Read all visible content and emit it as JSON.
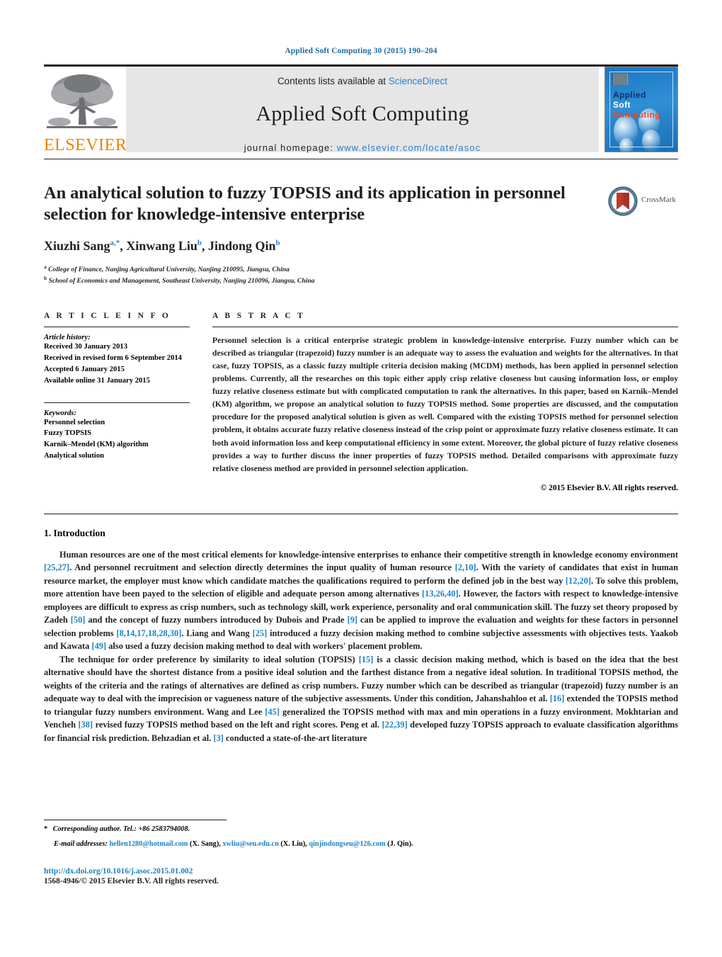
{
  "running_head": "Applied Soft Computing 30 (2015) 190–204",
  "masthead": {
    "publisher_word": "ELSEVIER",
    "contents_prefix": "Contents lists available at ",
    "contents_link": "ScienceDirect",
    "journal_title": "Applied Soft Computing",
    "homepage_label": "journal homepage:",
    "homepage_url": "www.elsevier.com/locate/asoc",
    "cover": {
      "line1": "Applied",
      "line2": "Soft",
      "line3": "Computing"
    }
  },
  "article": {
    "title": "An analytical solution to fuzzy TOPSIS and its application in personnel selection for knowledge-intensive enterprise",
    "authors_html": "Xiuzhi Sang<sup>a,*</sup>, Xinwang Liu<sup>b</sup>, Jindong Qin<sup>b</sup>",
    "affiliations": [
      {
        "mark": "a",
        "text": "College of Finance, Nanjing Agricultural University, Nanjing 210095, Jiangsu, China"
      },
      {
        "mark": "b",
        "text": "School of Economics and Management, Southeast University, Nanjing 210096, Jiangsu, China"
      }
    ],
    "crossmark_label": "CrossMark"
  },
  "info": {
    "heading": "A R T I C L E   I N F O",
    "history_title": "Article history:",
    "history": [
      "Received 30 January 2013",
      "Received in revised form 6 September 2014",
      "Accepted 6 January 2015",
      "Available online 31 January 2015"
    ],
    "keywords_title": "Keywords:",
    "keywords": [
      "Personnel selection",
      "Fuzzy TOPSIS",
      "Karnik–Mendel (KM) algorithm",
      "Analytical solution"
    ]
  },
  "abstract": {
    "heading": "A B S T R A C T",
    "text": "Personnel selection is a critical enterprise strategic problem in knowledge-intensive enterprise. Fuzzy number which can be described as triangular (trapezoid) fuzzy number is an adequate way to assess the evaluation and weights for the alternatives. In that case, fuzzy TOPSIS, as a classic fuzzy multiple criteria decision making (MCDM) methods, has been applied in personnel selection problems. Currently, all the researches on this topic either apply crisp relative closeness but causing information loss, or employ fuzzy relative closeness estimate but with complicated computation to rank the alternatives. In this paper, based on Karnik–Mendel (KM) algorithm, we propose an analytical solution to fuzzy TOPSIS method. Some properties are discussed, and the computation procedure for the proposed analytical solution is given as well. Compared with the existing TOPSIS method for personnel selection problem, it obtains accurate fuzzy relative closeness instead of the crisp point or approximate fuzzy relative closeness estimate. It can both avoid information loss and keep computational efficiency in some extent. Moreover, the global picture of fuzzy relative closeness provides a way to further discuss the inner properties of fuzzy TOPSIS method. Detailed comparisons with approximate fuzzy relative closeness method are provided in personnel selection application.",
    "copyright": "© 2015 Elsevier B.V. All rights reserved."
  },
  "introduction": {
    "heading": "1.  Introduction",
    "paragraph1_html": "Human resources are one of the most critical elements for knowledge-intensive enterprises to enhance their competitive strength in knowledge economy environment <span class=\"cite\">[25,27]</span>. And personnel recruitment and selection directly determines the input quality of human resource <span class=\"cite\">[2,10]</span>. With the variety of candidates that exist in human resource market, the employer must know which candidate matches the qualifications required to perform the defined job in the best way <span class=\"cite\">[12,20]</span>. To solve this problem, more attention have been payed to the selection of eligible and adequate person among alternatives <span class=\"cite\">[13,26,40]</span>. However, the factors with respect to knowledge-intensive employees are difficult to express as crisp numbers, such as technology skill, work experience, personality and oral communication skill. The fuzzy set theory proposed by Zadeh <span class=\"cite\">[50]</span> and the concept of fuzzy numbers introduced by Dubois and Prade <span class=\"cite\">[9]</span> can be applied to improve the evaluation and weights for these factors in personnel selection problems <span class=\"cite\">[8,14,17,18,28,30]</span>. Liang and Wang <span class=\"cite\">[25]</span> introduced a fuzzy decision making method to combine subjective assessments with objectives tests. Yaakob and Kawata <span class=\"cite\">[49]</span> also used a fuzzy decision making method to deal with workers' placement problem.",
    "paragraph2_html": "The technique for order preference by similarity to ideal solution (TOPSIS) <span class=\"cite\">[15]</span> is a classic decision making method, which is based on the idea that the best alternative should have the shortest distance from a positive ideal solution and the farthest distance from a negative ideal solution. In traditional TOPSIS method, the weights of the criteria and the ratings of alternatives are defined as crisp numbers. Fuzzy number which can be described as triangular (trapezoid) fuzzy number is an adequate way to deal with the imprecision or vagueness nature of the subjective assessments. Under this condition, Jahanshahloo et al. <span class=\"cite\">[16]</span> extended the TOPSIS method to triangular fuzzy numbers environment. Wang and Lee <span class=\"cite\">[45]</span> generalized the TOPSIS method with max and min operations in a fuzzy environment. Mokhtarian and Vencheh <span class=\"cite\">[38]</span> revised fuzzy TOPSIS method based on the left and right scores. Peng et al. <span class=\"cite\">[22,39]</span> developed fuzzy TOPSIS approach to evaluate classification algorithms for financial risk prediction. Behzadian et al. <span class=\"cite\">[3]</span> conducted a state-of-the-art literature"
  },
  "footnote": {
    "corresponding_html": "<span class=\"star\">*</span> <span class=\"fn-ital\">Corresponding author. Tel.: +86 2583794008.</span>",
    "emails_html": "<span class=\"fn-ital\">E-mail addresses:</span> <span class=\"link\">hellen1280@hotmail.com</span> (X. Sang), <span class=\"link\">xwliu@seu.edu.cn</span> (X. Liu), <span class=\"link\">qinjindongseu@126.com</span> (J. Qin).",
    "doi": "http://dx.doi.org/10.1016/j.asoc.2015.01.002",
    "issn": "1568-4946/© 2015 Elsevier B.V. All rights reserved."
  }
}
